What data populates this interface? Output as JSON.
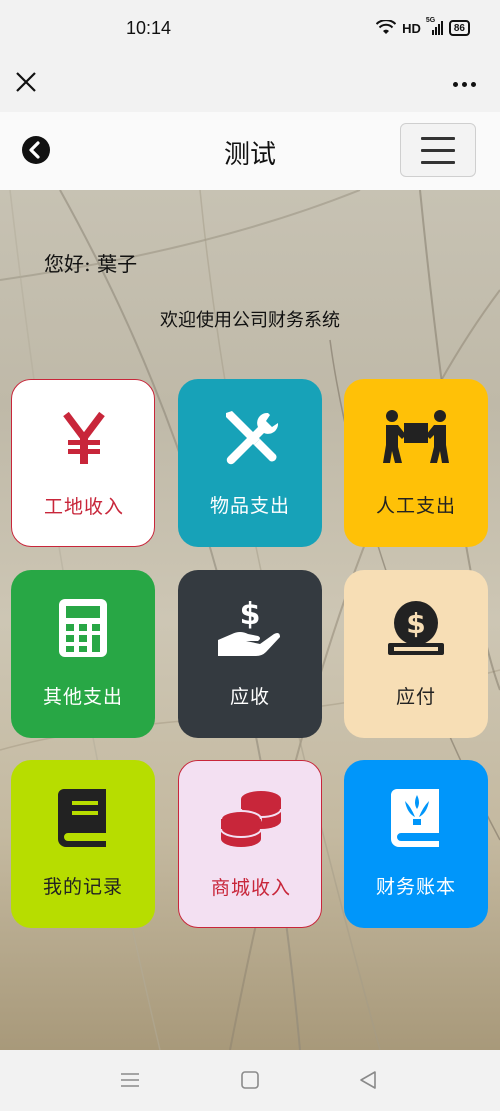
{
  "status_bar": {
    "time": "10:14",
    "network": "HD",
    "signal": "5G",
    "battery": "86"
  },
  "webview": {
    "close_icon": "close-icon",
    "more_icon": "more-dots-icon"
  },
  "header": {
    "title": "测试",
    "back_icon": "back-arrow-icon",
    "menu_icon": "hamburger-menu-icon"
  },
  "main": {
    "greeting": "您好: 葉子",
    "welcome": "欢迎使用公司财务系统",
    "tiles": [
      {
        "label": "工地收入",
        "icon": "yen-icon",
        "bg": "#ffffff",
        "fg": "#c8263a"
      },
      {
        "label": "物品支出",
        "icon": "tools-icon",
        "bg": "#17a2b8",
        "fg": "#ffffff"
      },
      {
        "label": "人工支出",
        "icon": "people-carry-icon",
        "bg": "#ffc107",
        "fg": "#222222"
      },
      {
        "label": "其他支出",
        "icon": "calculator-icon",
        "bg": "#28a745",
        "fg": "#ffffff"
      },
      {
        "label": "应收",
        "icon": "hand-dollar-icon",
        "bg": "#343a40",
        "fg": "#ffffff"
      },
      {
        "label": "应付",
        "icon": "coin-slot-icon",
        "bg": "#f7deb5",
        "fg": "#222222"
      },
      {
        "label": "我的记录",
        "icon": "book-icon",
        "bg": "#b7dd00",
        "fg": "#222222"
      },
      {
        "label": "商城收入",
        "icon": "coins-icon",
        "bg": "#f3e0f2",
        "fg": "#c8263a"
      },
      {
        "label": "财务账本",
        "icon": "journal-icon",
        "bg": "#0096fa",
        "fg": "#ffffff"
      }
    ]
  },
  "nav_bar": {
    "menu_icon": "nav-menu-icon",
    "home_icon": "nav-home-icon",
    "back_icon": "nav-back-icon"
  }
}
